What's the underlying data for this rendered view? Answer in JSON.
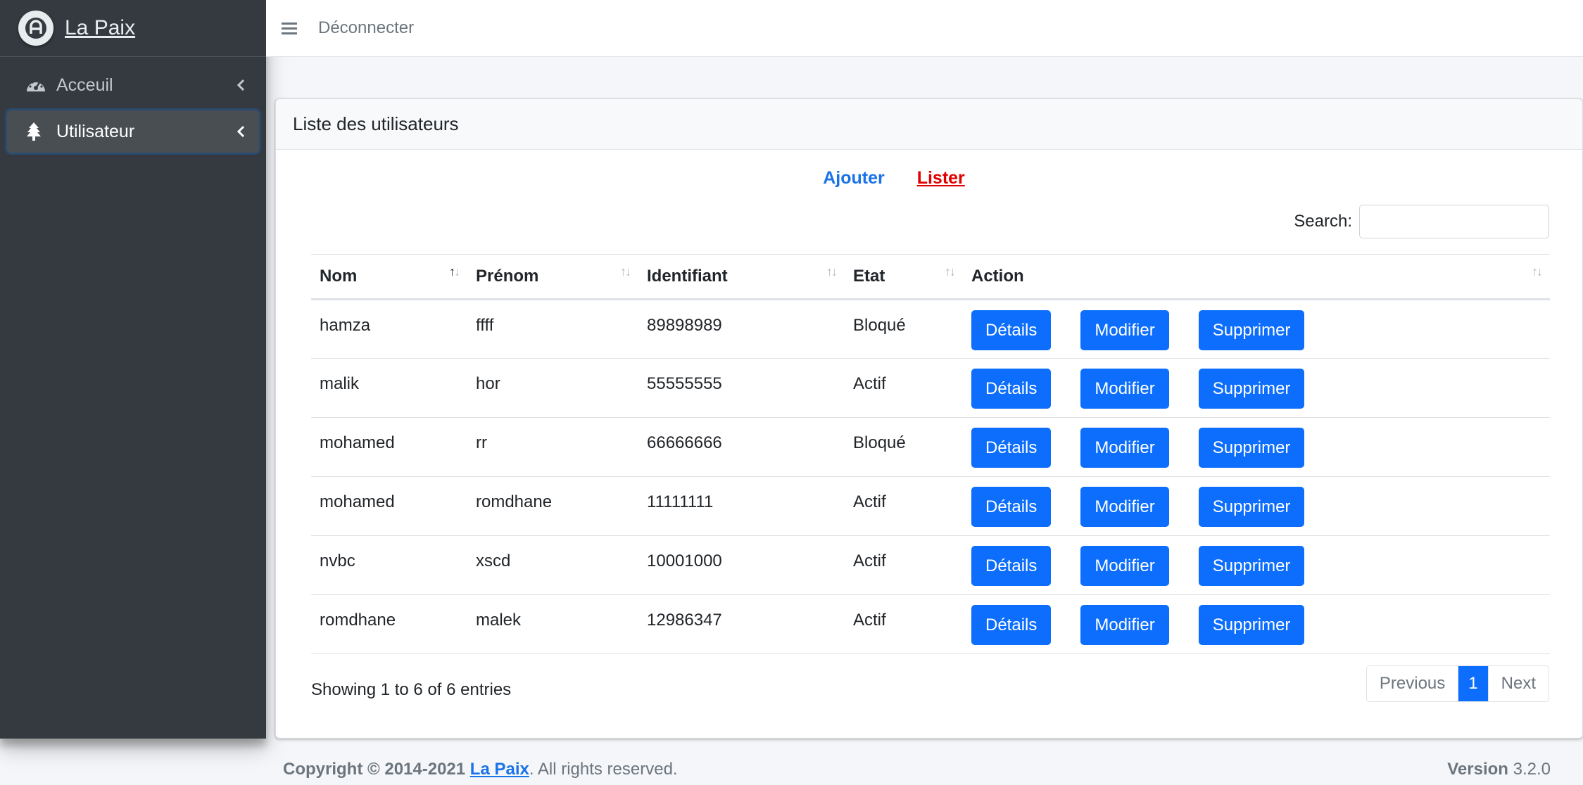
{
  "brand": {
    "name": "La Paix"
  },
  "sidebar": {
    "items": [
      {
        "label": "Acceuil",
        "icon": "tachometer-icon"
      },
      {
        "label": "Utilisateur",
        "icon": "tree-icon"
      }
    ]
  },
  "topbar": {
    "logout_label": "Déconnecter"
  },
  "card": {
    "title": "Liste des utilisateurs",
    "link_add": "Ajouter",
    "link_list": "Lister",
    "search_label": "Search:",
    "search_value": ""
  },
  "table": {
    "headers": [
      "Nom",
      "Prénom",
      "Identifiant",
      "Etat",
      "Action"
    ],
    "rows": [
      {
        "nom": "hamza",
        "prenom": "ffff",
        "identifiant": "89898989",
        "etat": "Bloqué"
      },
      {
        "nom": "malik",
        "prenom": "hor",
        "identifiant": "55555555",
        "etat": "Actif"
      },
      {
        "nom": "mohamed",
        "prenom": "rr",
        "identifiant": "66666666",
        "etat": "Bloqué"
      },
      {
        "nom": "mohamed",
        "prenom": "romdhane",
        "identifiant": "11111111",
        "etat": "Actif"
      },
      {
        "nom": "nvbc",
        "prenom": "xscd",
        "identifiant": "10001000",
        "etat": "Actif"
      },
      {
        "nom": "romdhane",
        "prenom": "malek",
        "identifiant": "12986347",
        "etat": "Actif"
      }
    ],
    "actions": {
      "details": "Détails",
      "edit": "Modifier",
      "delete": "Supprimer"
    },
    "info": "Showing 1 to 6 of 6 entries"
  },
  "pagination": {
    "previous": "Previous",
    "current": "1",
    "next": "Next"
  },
  "footer": {
    "copyright_prefix": "Copyright © 2014-2021",
    "copyright_link": "La Paix",
    "copyright_suffix": ". All rights reserved.",
    "version_label": "Version",
    "version_value": "3.2.0"
  },
  "colors": {
    "sidebar": "#343a40",
    "primary": "#0d6efd",
    "link_active": "#e00000"
  }
}
